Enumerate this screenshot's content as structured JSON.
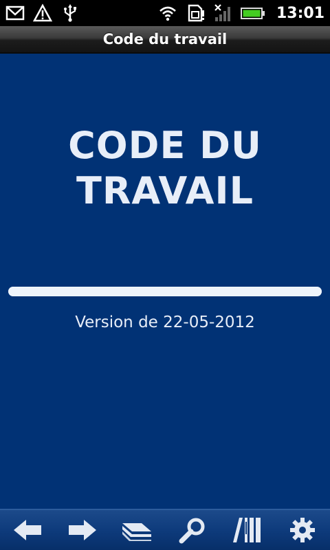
{
  "status_bar": {
    "time": "13:01",
    "icons": [
      "gmail-icon",
      "warning-icon",
      "usb-icon",
      "wifi-icon",
      "sim-icon",
      "signal-icon",
      "battery-icon"
    ]
  },
  "title_bar": {
    "title": "Code du travail"
  },
  "main": {
    "book_title": "CODE DU TRAVAIL",
    "version": "Version de 22-05-2012",
    "progress": 1.0,
    "background_color": "#013275"
  },
  "toolbar": {
    "buttons": [
      "back-icon",
      "forward-icon",
      "book-icon",
      "search-icon",
      "library-icon",
      "settings-icon"
    ]
  }
}
